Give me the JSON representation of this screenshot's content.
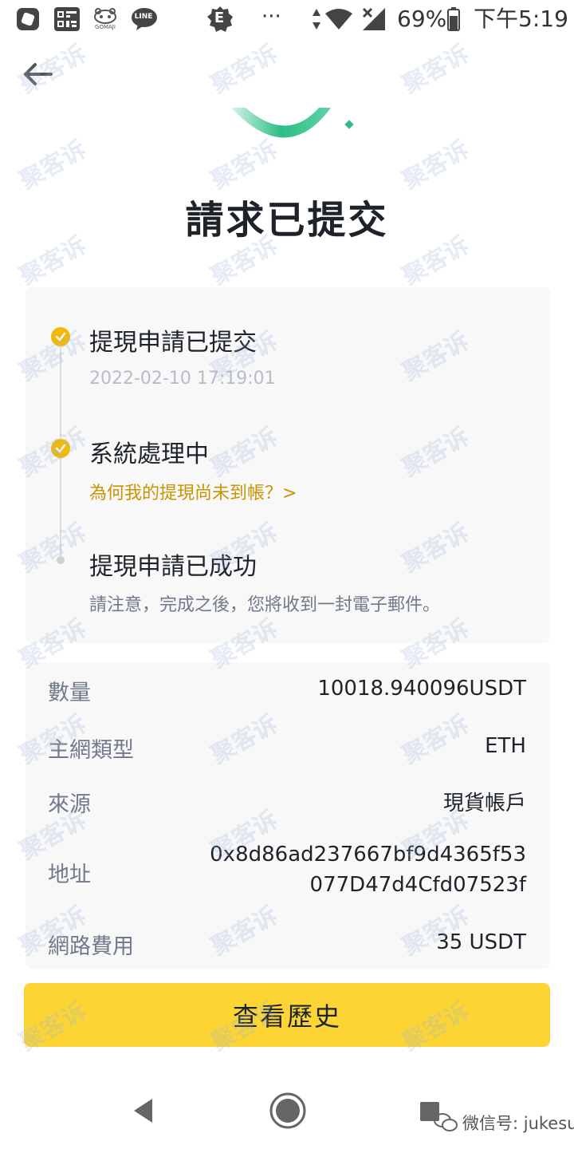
{
  "status_bar": {
    "notification_icons": [
      "app-icon",
      "qr-scan-icon",
      "gomaji-icon",
      "line-icon",
      "e-app-icon"
    ],
    "gomaji_label": "GOMAJI",
    "line_label": "LINE",
    "e_app_label": "E",
    "more": "···",
    "battery": "69%",
    "battery_level": 0.69,
    "time": "下午5:19"
  },
  "header": {
    "title": "請求已提交"
  },
  "steps": [
    {
      "title": "提現申請已提交",
      "subtitle": "2022-02-10 17:19:01",
      "status": "done"
    },
    {
      "title": "系統處理中",
      "link": "為何我的提現尚未到帳？>",
      "status": "done"
    },
    {
      "title": "提現申請已成功",
      "note": "請注意，完成之後，您將收到一封電子郵件。",
      "status": "pending"
    }
  ],
  "details": {
    "amount": {
      "label": "數量",
      "value": "10018.940096USDT"
    },
    "network": {
      "label": "主網類型",
      "value": "ETH"
    },
    "source": {
      "label": "來源",
      "value": "現貨帳戶"
    },
    "address": {
      "label": "地址",
      "value_line1": "0x8d86ad237667bf9d4365f53",
      "value_line2": "077D47d4Cfd07523f"
    },
    "fee": {
      "label": "網路費用",
      "value": "35 USDT"
    }
  },
  "actions": {
    "history_label": "查看歷史"
  },
  "watermark": {
    "text": "聚客诉",
    "wechat_label": "微信号: jukesu"
  },
  "colors": {
    "accent_yellow": "#fcd535",
    "step_gold": "#f0b90b",
    "link_gold": "#c99400",
    "success_green": "#2ebd85",
    "card_bg": "#f8f8f9"
  }
}
